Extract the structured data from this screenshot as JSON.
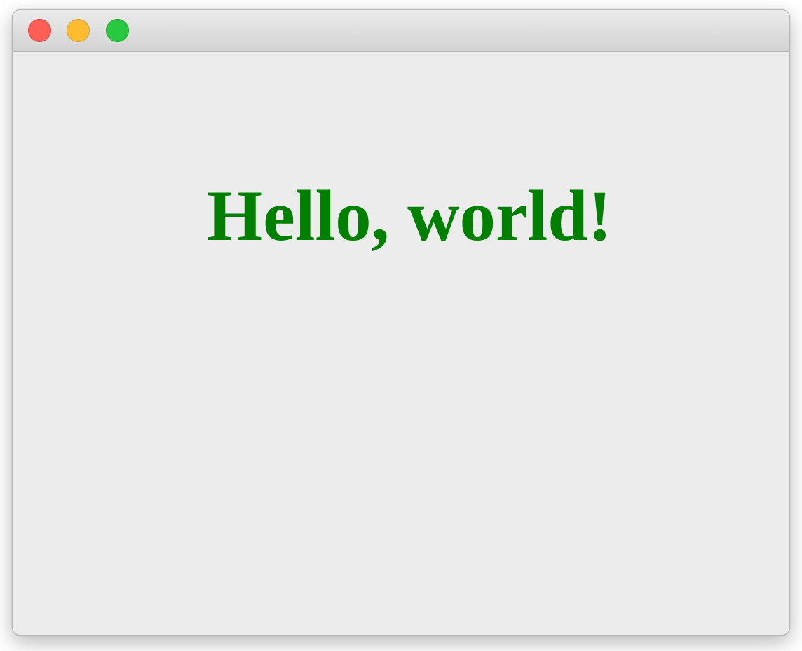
{
  "window": {
    "traffic_lights": {
      "close": {
        "icon": "close-circle-icon",
        "fill": "#ff5f57",
        "border": "#e0443e"
      },
      "minimize": {
        "icon": "minimize-circle-icon",
        "fill": "#febc2e",
        "border": "#dea123"
      },
      "zoom": {
        "icon": "zoom-circle-icon",
        "fill": "#28c840",
        "border": "#1aab29"
      }
    },
    "background": "#ececec"
  },
  "content": {
    "greeting": "Hello, world!",
    "greeting_color": "#008000"
  }
}
